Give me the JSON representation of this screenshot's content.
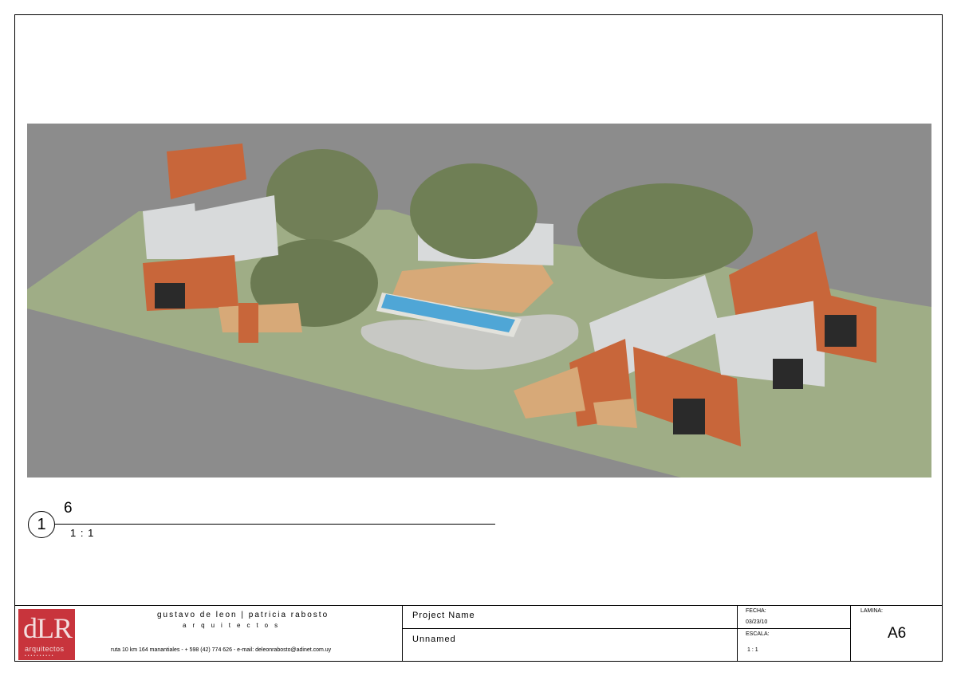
{
  "view": {
    "circle_number": "1",
    "number": "6",
    "scale": "1 : 1"
  },
  "titleblock": {
    "logo_mark": "dLR",
    "logo_sub": "arquitectos",
    "logo_dots": "••••••••••",
    "firm_name": "gustavo de leon | patricia rabosto",
    "firm_sub": "arquitectos",
    "firm_address": "ruta 10 km 164 manantiales - + 598 (42) 774 626 - e-mail: deleonrabosto@adinet.com.uy",
    "project_name_label": "Project Name",
    "project_name_value": "Unnamed",
    "fecha_label": "FECHA:",
    "fecha_value": "03/23/10",
    "escala_label": "ESCALA:",
    "escala_value": "1 : 1",
    "lamina_label": "LAMINA:",
    "lamina_value": "A6"
  },
  "colors": {
    "ground_gray": "#8c8c8c",
    "lawn": "#9fad86",
    "container_orange": "#c8663a",
    "container_white": "#d8dadb",
    "deck": "#d7a978",
    "pool": "#4fa6d6",
    "tree": "#6f7f55",
    "logo_red": "#c8343c"
  }
}
